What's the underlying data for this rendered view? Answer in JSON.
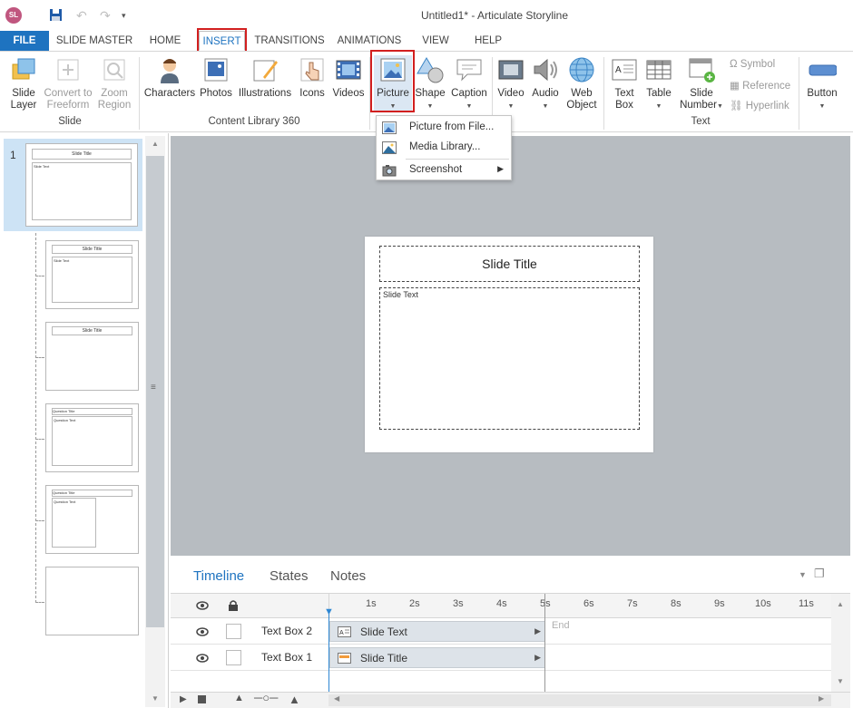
{
  "window": {
    "app_badge": "SL",
    "title": "Untitled1* -  Articulate Storyline"
  },
  "tabs": [
    {
      "label": "FILE"
    },
    {
      "label": "SLIDE MASTER"
    },
    {
      "label": "HOME"
    },
    {
      "label": "INSERT"
    },
    {
      "label": "TRANSITIONS"
    },
    {
      "label": "ANIMATIONS"
    },
    {
      "label": "VIEW"
    },
    {
      "label": "HELP"
    }
  ],
  "ribbon": {
    "slide_group": {
      "label": "Slide",
      "slide_layer": "Slide Layer",
      "convert_freeform": "Convert to Freeform",
      "zoom_region": "Zoom Region"
    },
    "content_library": {
      "label": "Content Library 360",
      "characters": "Characters",
      "photos": "Photos",
      "illustrations": "Illustrations",
      "icons": "Icons",
      "videos": "Videos"
    },
    "picture": "Picture",
    "shape": "Shape",
    "caption": "Caption",
    "video": "Video",
    "audio": "Audio",
    "web_object": "Web Object",
    "text_group": {
      "label": "Text",
      "text_box": "Text Box",
      "table": "Table",
      "slide_number": "Slide Number",
      "symbol": "Symbol",
      "reference": "Reference",
      "hyperlink": "Hyperlink"
    },
    "button": "Button"
  },
  "picture_menu": {
    "items": [
      {
        "label": "Picture from File..."
      },
      {
        "label": "Media Library..."
      },
      {
        "label": "Screenshot"
      }
    ]
  },
  "slides_panel": {
    "slide_number": "1",
    "thumb_title": "Slide Title",
    "thumb_text": "Slide Text",
    "question_title": "Question Title",
    "question_text": "Question Text"
  },
  "slide": {
    "title": "Slide Title",
    "body": "Slide Text"
  },
  "timeline": {
    "tabs": [
      {
        "label": "Timeline"
      },
      {
        "label": "States"
      },
      {
        "label": "Notes"
      }
    ],
    "ticks": [
      "1s",
      "2s",
      "3s",
      "4s",
      "5s",
      "6s",
      "7s",
      "8s",
      "9s",
      "10s",
      "11s"
    ],
    "end_label": "End",
    "rows": [
      {
        "name": "Text Box 2",
        "bar": "Slide Text"
      },
      {
        "name": "Text Box 1",
        "bar": "Slide Title"
      }
    ]
  },
  "colors": {
    "accent": "#1e73c0",
    "highlight": "#d21f1f",
    "canvas_bg": "#b7bcc1"
  }
}
